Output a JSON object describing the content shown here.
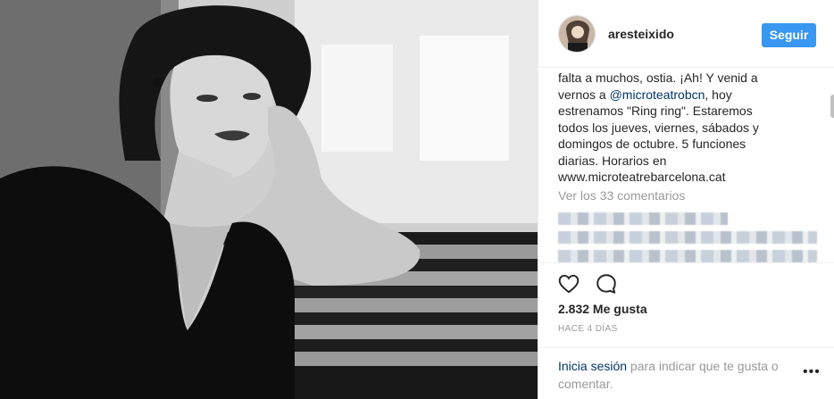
{
  "post": {
    "username": "aresteixido",
    "follow_label": "Seguir",
    "caption_lines": [
      "falta a muchos, ostia. ¡Ah! Y venid a",
      "vernos a ",
      "@microteatrobcn",
      ", hoy",
      "estrenamos \"Ring ring\". Estaremos",
      "todos los jueves, viernes, sábados y",
      "domingos de octubre. 5 funciones",
      "diarias. Horarios en",
      "www.microteatrebarcelona.cat"
    ],
    "view_all_comments": "Ver los 33 comentarios",
    "likes": "2.832 Me gusta",
    "time_ago": "HACE 4 DÍAS",
    "login_link": "Inicia sesión",
    "login_rest": " para indicar que te gusta o comentar.",
    "more_label": "•••"
  },
  "colors": {
    "accent": "#3897f0",
    "link": "#003569",
    "muted": "#999999"
  },
  "icons": {
    "like": "heart-icon",
    "comment": "comment-icon",
    "more": "more-options-icon"
  }
}
